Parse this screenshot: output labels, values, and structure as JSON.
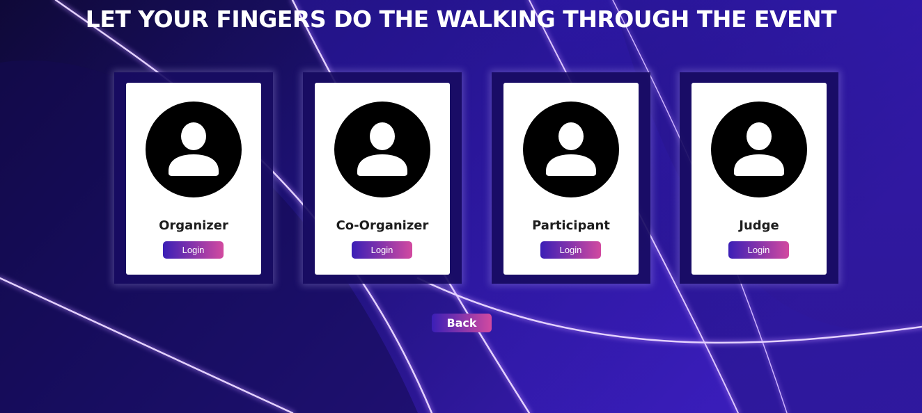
{
  "page": {
    "title": "LET YOUR FINGERS DO THE WALKING THROUGH THE EVENT",
    "background_colors": {
      "dark": "#120a45",
      "mid": "#2a17a6",
      "glow": "#b98cff"
    }
  },
  "roles": [
    {
      "label": "Organizer",
      "button": "Login",
      "icon": "user-avatar-icon"
    },
    {
      "label": "Co-Organizer",
      "button": "Login",
      "icon": "user-avatar-icon"
    },
    {
      "label": "Participant",
      "button": "Login",
      "icon": "user-avatar-icon"
    },
    {
      "label": "Judge",
      "button": "Login",
      "icon": "user-avatar-icon"
    }
  ],
  "back_button": {
    "label": "Back"
  },
  "colors": {
    "button_gradient_start": "#3b1fb6",
    "button_gradient_end": "#d24aa0",
    "card_background": "#ffffff",
    "icon_color": "#000000"
  }
}
